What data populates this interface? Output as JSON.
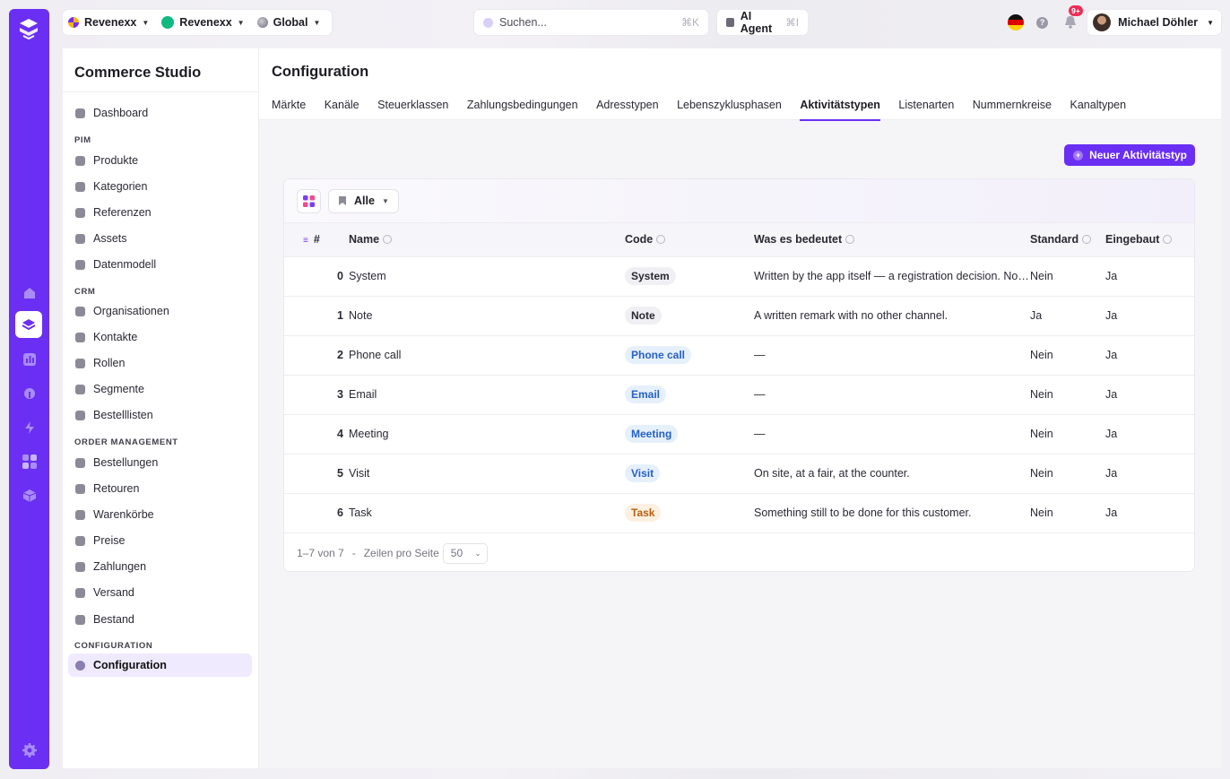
{
  "topbar": {
    "contexts": [
      {
        "label": "Revenexx",
        "dot_color": "#f2b519"
      },
      {
        "label": "Revenexx",
        "dot_color": "#10b981"
      },
      {
        "label": "Global",
        "dot_color": "#8d8a97"
      }
    ],
    "search": {
      "placeholder": "Suchen...",
      "shortcut": "⌘K"
    },
    "ai_agent": {
      "label": "AI Agent",
      "shortcut": "⌘I"
    },
    "notifications_badge": "9+",
    "help": "?",
    "user": {
      "name": "Michael Döhler"
    }
  },
  "sidebar": {
    "title": "Commerce Studio",
    "dashboard": "Dashboard",
    "sections": [
      {
        "heading": "PIM",
        "items": [
          "Produkte",
          "Kategorien",
          "Referenzen",
          "Assets",
          "Datenmodell"
        ]
      },
      {
        "heading": "CRM",
        "items": [
          "Organisationen",
          "Kontakte",
          "Rollen",
          "Segmente",
          "Bestelllisten"
        ]
      },
      {
        "heading": "ORDER MANAGEMENT",
        "items": [
          "Bestellungen",
          "Retouren",
          "Warenkörbe",
          "Preise",
          "Zahlungen",
          "Versand",
          "Bestand"
        ]
      },
      {
        "heading": "CONFIGURATION",
        "items": [
          "Configuration"
        ]
      }
    ],
    "active_item": "Configuration"
  },
  "main": {
    "title": "Configuration",
    "tabs": [
      "Märkte",
      "Kanäle",
      "Steuerklassen",
      "Zahlungsbedingungen",
      "Adresstypen",
      "Lebenszyklusphasen",
      "Aktivitätstypen",
      "Listenarten",
      "Nummernkreise",
      "Kanaltypen"
    ],
    "active_tab": "Aktivitätstypen",
    "new_button": "Neuer Aktivitätstyp",
    "filter_label": "Alle",
    "table": {
      "headers": {
        "index": "#",
        "name": "Name",
        "code": "Code",
        "meaning": "Was es bedeutet",
        "default": "Standard",
        "builtin": "Eingebaut"
      },
      "rows": [
        {
          "index": "0",
          "name": "System",
          "code": "System",
          "code_style": "gray",
          "meaning": "Written by the app itself — a registration decision. Not ...",
          "default": "Nein",
          "builtin": "Ja"
        },
        {
          "index": "1",
          "name": "Note",
          "code": "Note",
          "code_style": "gray",
          "meaning": "A written remark with no other channel.",
          "default": "Ja",
          "builtin": "Ja"
        },
        {
          "index": "2",
          "name": "Phone call",
          "code": "Phone call",
          "code_style": "blue",
          "meaning": "—",
          "default": "Nein",
          "builtin": "Ja"
        },
        {
          "index": "3",
          "name": "Email",
          "code": "Email",
          "code_style": "blue",
          "meaning": "—",
          "default": "Nein",
          "builtin": "Ja"
        },
        {
          "index": "4",
          "name": "Meeting",
          "code": "Meeting",
          "code_style": "blue",
          "meaning": "—",
          "default": "Nein",
          "builtin": "Ja"
        },
        {
          "index": "5",
          "name": "Visit",
          "code": "Visit",
          "code_style": "blue",
          "meaning": "On site, at a fair, at the counter.",
          "default": "Nein",
          "builtin": "Ja"
        },
        {
          "index": "6",
          "name": "Task",
          "code": "Task",
          "code_style": "orange",
          "meaning": "Something still to be done for this customer.",
          "default": "Nein",
          "builtin": "Ja"
        }
      ]
    },
    "pagination": {
      "range": "1–7 von 7",
      "separator": "-",
      "rows_label": "Zeilen pro Seite",
      "rows_value": "50"
    }
  },
  "colors": {
    "accent": "#6a2ff2"
  }
}
